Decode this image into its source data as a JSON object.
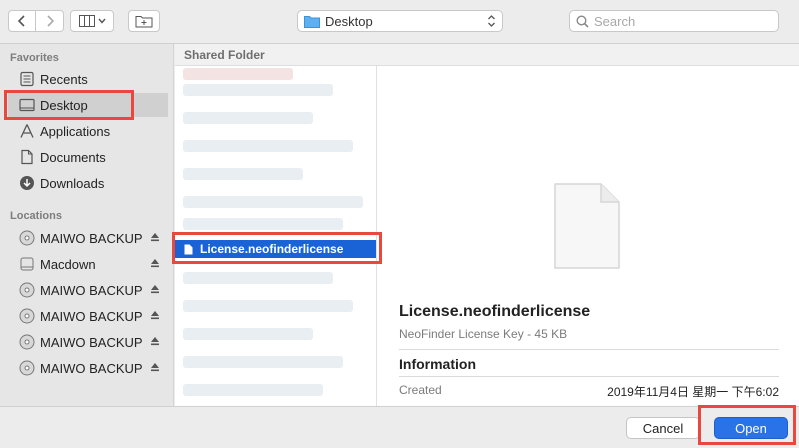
{
  "toolbar": {
    "location": "Desktop",
    "search_placeholder": "Search"
  },
  "sidebar": {
    "favorites_label": "Favorites",
    "favorites": [
      {
        "label": "Recents",
        "icon": "recents-icon"
      },
      {
        "label": "Desktop",
        "icon": "desktop-icon"
      },
      {
        "label": "Applications",
        "icon": "applications-icon"
      },
      {
        "label": "Documents",
        "icon": "documents-icon"
      },
      {
        "label": "Downloads",
        "icon": "downloads-icon"
      }
    ],
    "locations_label": "Locations",
    "locations": [
      {
        "label": "MAIWO BACKUP",
        "icon": "disk-icon"
      },
      {
        "label": "Macdown",
        "icon": "drive-icon"
      },
      {
        "label": "MAIWO BACKUP",
        "icon": "disk-icon"
      },
      {
        "label": "MAIWO BACKUP",
        "icon": "disk-icon"
      },
      {
        "label": "MAIWO BACKUP",
        "icon": "disk-icon"
      },
      {
        "label": "MAIWO BACKUP",
        "icon": "disk-icon"
      }
    ]
  },
  "main": {
    "header": "Shared Folder",
    "selected_file": "License.neofinderlicense"
  },
  "preview": {
    "name": "License.neofinderlicense",
    "kind": "NeoFinder License Key - 45 KB",
    "info_heading": "Information",
    "created_label": "Created",
    "created_value": "2019年11月4日 星期一 下午6:02"
  },
  "buttons": {
    "cancel": "Cancel",
    "open": "Open"
  },
  "colors": {
    "accent": "#1a63d6",
    "highlight": "#e8483d"
  }
}
